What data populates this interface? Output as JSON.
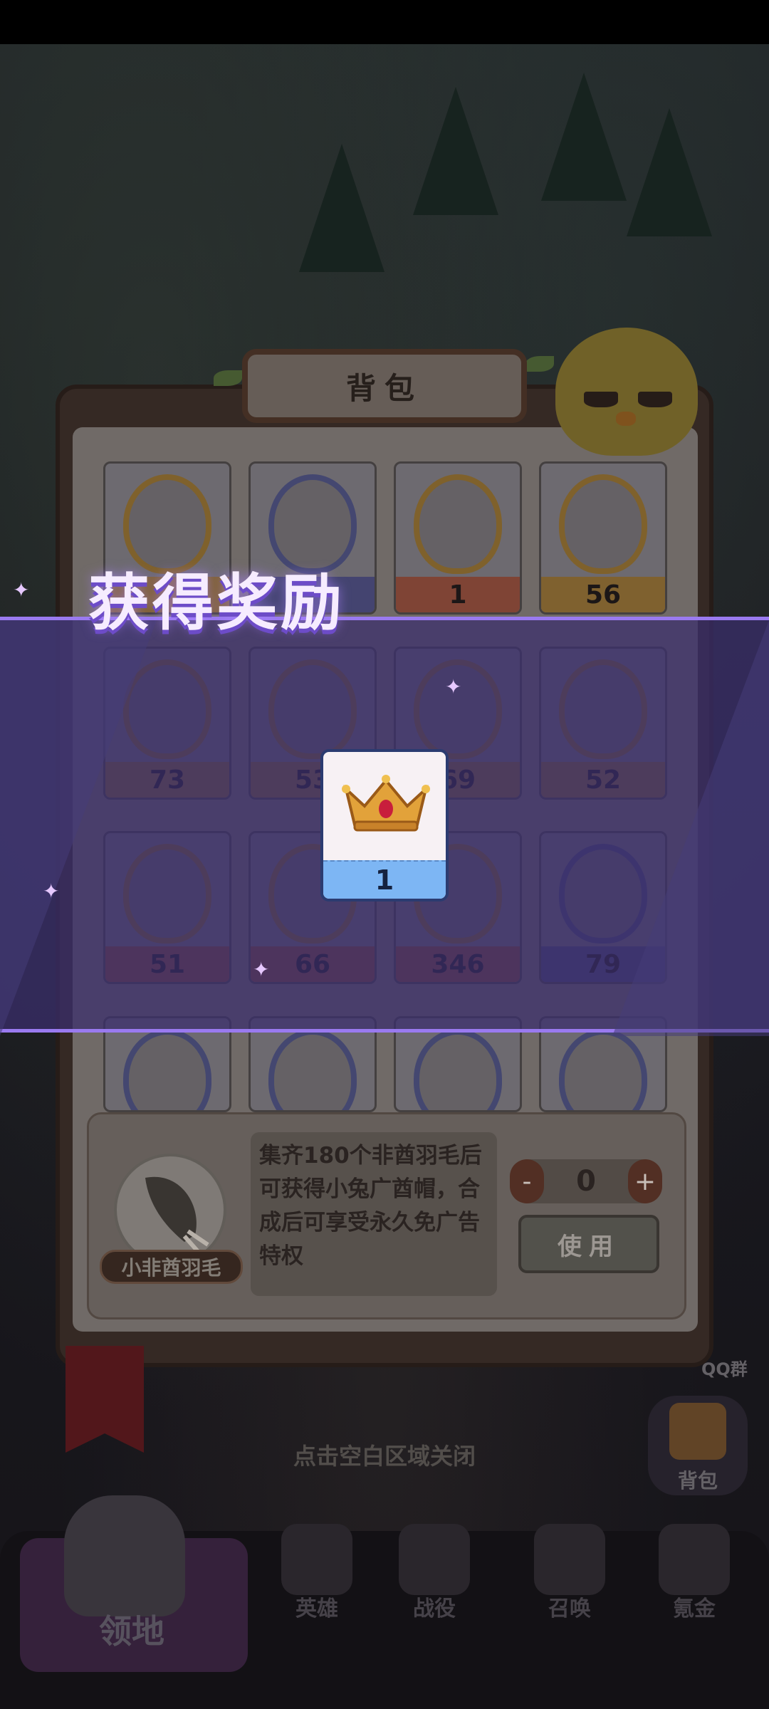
{
  "panel": {
    "title": "背包"
  },
  "reward": {
    "title": "获得奖励",
    "item": {
      "name": "crown",
      "count": "1"
    }
  },
  "grid": {
    "rows": [
      [
        {
          "icon": "feather-icon",
          "count": "",
          "bar": "orange"
        },
        {
          "icon": "gold-nugget-icon",
          "count": "",
          "bar": "blue"
        },
        {
          "icon": "crown-icon",
          "count": "1",
          "bar": "red"
        },
        {
          "icon": "hero-portrait-icon",
          "count": "56",
          "bar": "orange"
        }
      ],
      [
        {
          "icon": "hero-portrait-icon",
          "count": "73",
          "bar": "orange"
        },
        {
          "icon": "hero-portrait-icon",
          "count": "53",
          "bar": "orange"
        },
        {
          "icon": "hero-portrait-icon",
          "count": "69",
          "bar": "orange"
        },
        {
          "icon": "hero-portrait-icon",
          "count": "52",
          "bar": "orange"
        }
      ],
      [
        {
          "icon": "hero-portrait-icon",
          "count": "51",
          "bar": "red"
        },
        {
          "icon": "hero-portrait-icon",
          "count": "66",
          "bar": "red"
        },
        {
          "icon": "feather-icon",
          "count": "346",
          "bar": "red"
        },
        {
          "icon": "hero-portrait-icon",
          "count": "79",
          "bar": "blue"
        }
      ],
      [
        {
          "icon": "hero-portrait-icon",
          "count": "",
          "bar": "blue-light"
        },
        {
          "icon": "hero-portrait-icon",
          "count": "",
          "bar": "blue-light"
        },
        {
          "icon": "hero-portrait-icon",
          "count": "",
          "bar": "blue-light"
        },
        {
          "icon": "hero-portrait-icon",
          "count": "",
          "bar": "blue-light"
        }
      ]
    ]
  },
  "selected_item": {
    "name": "小非酋羽毛",
    "description": "集齐180个非酋羽毛后可获得小兔广酋帽，合成后可享受永久免广告特权",
    "quantity": "0",
    "minus_label": "-",
    "plus_label": "+",
    "use_label": "使用"
  },
  "close_hint": "点击空白区域关闭",
  "side": {
    "qq_label": "QQ群",
    "bag_label": "背包"
  },
  "nav": {
    "home_label": "领地",
    "items": [
      {
        "label": "英雄",
        "icon": "book-icon"
      },
      {
        "label": "战役",
        "icon": "chick-icon"
      },
      {
        "label": "召唤",
        "icon": "summon-icon"
      },
      {
        "label": "氪金",
        "icon": "treasure-icon"
      }
    ]
  },
  "colors": {
    "accent_purple": "#9a7af0",
    "reward_bar": "#7db6f4"
  }
}
